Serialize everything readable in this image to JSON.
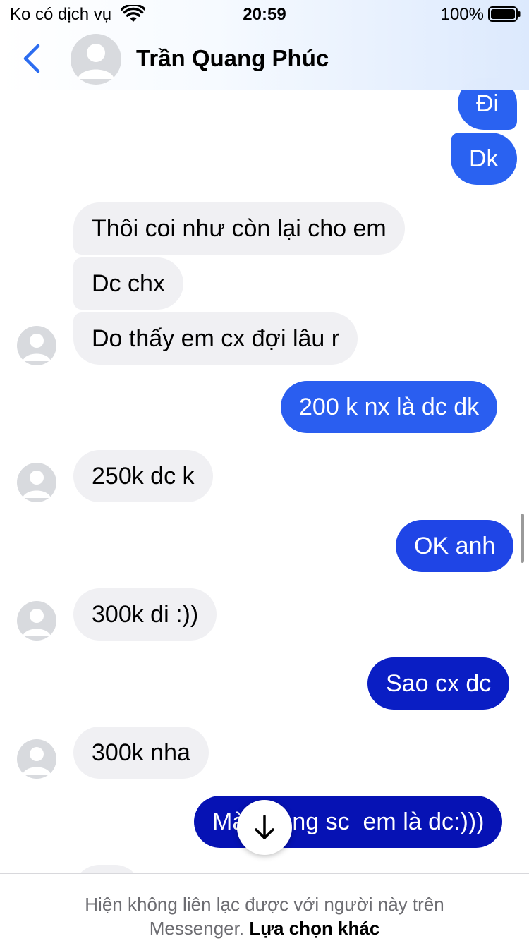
{
  "status_bar": {
    "carrier": "Ko có dịch vụ",
    "time": "20:59",
    "battery": "100%"
  },
  "header": {
    "contact_name": "Trần Quang Phúc"
  },
  "colors": {
    "incoming_bubble": "#f0f0f3",
    "outgoing_light": "#2a63f0",
    "outgoing_dark": "#0612b4",
    "accent_back": "#2c6cf0"
  },
  "messages": [
    {
      "dir": "out",
      "text": "Đi"
    },
    {
      "dir": "out",
      "text": "Dk"
    },
    {
      "dir": "in",
      "text": "Thôi coi như còn lại cho em"
    },
    {
      "dir": "in",
      "text": "Dc chx"
    },
    {
      "dir": "in",
      "text": "Do thấy em cx đợi lâu r"
    },
    {
      "dir": "out",
      "text": "200 k nx là dc dk"
    },
    {
      "dir": "in",
      "text": "250k dc k"
    },
    {
      "dir": "out",
      "text": "OK anh"
    },
    {
      "dir": "in",
      "text": "300k di :))"
    },
    {
      "dir": "out",
      "text": "Sao cx dc"
    },
    {
      "dir": "in",
      "text": "300k nha"
    },
    {
      "dir": "out",
      "text": "Mà       ng sc  em là dc:)))"
    }
  ],
  "footer": {
    "line1": "Hiện không liên lạc được với người này trên",
    "line2_prefix": "Messenger. ",
    "link": "Lựa chọn khác"
  },
  "icons": {
    "back": "chevron-left-icon",
    "scroll_down": "arrow-down-icon",
    "wifi": "wifi-icon",
    "battery": "battery-icon"
  }
}
